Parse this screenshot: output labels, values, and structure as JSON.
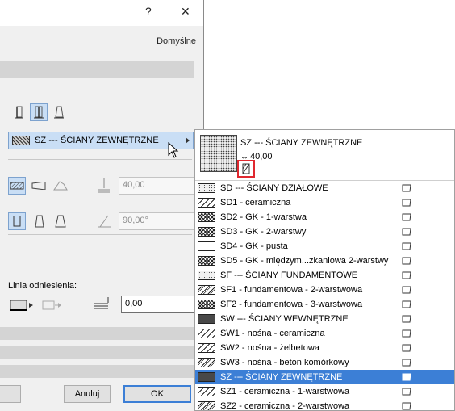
{
  "dialog": {
    "help_glyph": "?",
    "close_glyph": "✕",
    "default_label": "Domyślne",
    "selected_fill": "SZ --- ŚCIANY ZEWNĘTRZNE",
    "thickness_value": "40,00",
    "angle_value": "90,00°",
    "reference_line_label": "Linia odniesienia:",
    "offset_value": "0,00",
    "cancel_label": "Anuluj",
    "ok_label": "OK"
  },
  "popup": {
    "preview_name": "SZ --- ŚCIANY ZEWNĘTRZNE",
    "preview_thickness": "40,00",
    "items": [
      {
        "label": "SD --- ŚCIANY DZIAŁOWE",
        "pattern": "dots-light",
        "selected": false
      },
      {
        "label": "SD1 - ceramiczna",
        "pattern": "diag-sparse",
        "selected": false
      },
      {
        "label": "SD2 - GK - 1-warstwa",
        "pattern": "cross-dense",
        "selected": false
      },
      {
        "label": "SD3 - GK - 2-warstwy",
        "pattern": "cross-dense",
        "selected": false
      },
      {
        "label": "SD4 - GK - pusta",
        "pattern": "empty",
        "selected": false
      },
      {
        "label": "SD5 - GK - międzym...zkaniowa 2-warstwy",
        "pattern": "cross-dense",
        "selected": false
      },
      {
        "label": "SF --- ŚCIANY FUNDAMENTOWE",
        "pattern": "dots-light",
        "selected": false
      },
      {
        "label": "SF1 - fundamentowa - 2-warstwowa",
        "pattern": "diag-double",
        "selected": false
      },
      {
        "label": "SF2 - fundamentowa - 3-warstwowa",
        "pattern": "cross-dense",
        "selected": false
      },
      {
        "label": "SW --- ŚCIANY WEWNĘTRZNE",
        "pattern": "dots-dark",
        "selected": false
      },
      {
        "label": "SW1 - nośna - ceramiczna",
        "pattern": "diag-sparse",
        "selected": false
      },
      {
        "label": "SW2 - nośna - żelbetowa",
        "pattern": "diag-sparse",
        "selected": false
      },
      {
        "label": "SW3 - nośna - beton komórkowy",
        "pattern": "diag-double",
        "selected": false
      },
      {
        "label": "SZ --- ŚCIANY ZEWNĘTRZNE",
        "pattern": "dots-dark",
        "selected": true
      },
      {
        "label": "SZ1 - ceramiczna - 1-warstwowa",
        "pattern": "diag-sparse",
        "selected": false
      },
      {
        "label": "SZ2 - ceramiczna - 2-warstwowa",
        "pattern": "diag-double",
        "selected": false
      }
    ]
  },
  "colors": {
    "selection": "#3c7fd6",
    "highlight": "#c9def5",
    "preview_border": "#e0282f"
  }
}
